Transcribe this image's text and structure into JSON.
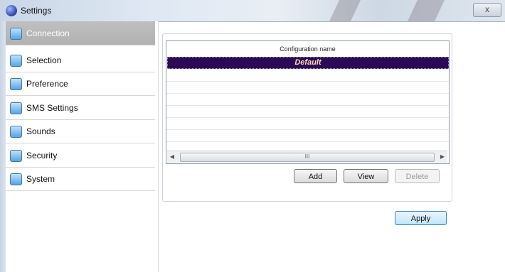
{
  "window": {
    "title": "Settings",
    "close_label": "x"
  },
  "sidebar": {
    "items": [
      {
        "label": "Connection",
        "icon": "connection-icon",
        "selected": true
      },
      {
        "label": "Selection",
        "icon": "selection-icon",
        "selected": false
      },
      {
        "label": "Preference",
        "icon": "preference-icon",
        "selected": false
      },
      {
        "label": "SMS Settings",
        "icon": "sms-icon",
        "selected": false
      },
      {
        "label": "Sounds",
        "icon": "sounds-icon",
        "selected": false
      },
      {
        "label": "Security",
        "icon": "security-icon",
        "selected": false
      },
      {
        "label": "System",
        "icon": "system-icon",
        "selected": false
      }
    ]
  },
  "config_table": {
    "column_header": "Configuration name",
    "rows": [
      "Default"
    ],
    "scroll_grip": "III"
  },
  "actions": {
    "add": "Add",
    "view": "View",
    "delete": "Delete"
  },
  "apply_label": "Apply",
  "colors": {
    "selected_row_bg": "#2a0a55",
    "selected_row_text": "#ffdcb0",
    "sidebar_selected_bg": "#b8b8b8"
  }
}
